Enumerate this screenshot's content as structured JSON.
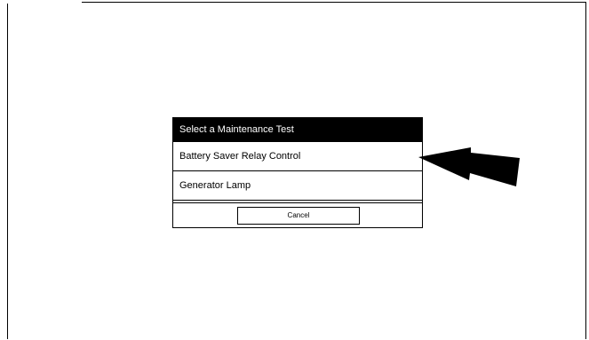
{
  "dialog": {
    "title": "Select a Maintenance Test",
    "options": [
      {
        "label": "Battery Saver Relay Control"
      },
      {
        "label": "Generator Lamp"
      }
    ],
    "cancel_label": "Cancel"
  },
  "annotation": {
    "arrow_icon": "arrow-left-icon",
    "color": "#000000"
  }
}
